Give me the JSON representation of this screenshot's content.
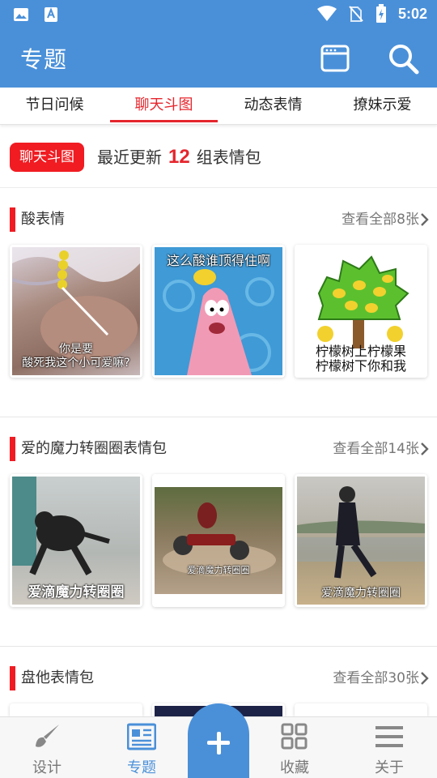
{
  "status_bar": {
    "time": "5:02"
  },
  "app_bar": {
    "title": "专题"
  },
  "tabs": [
    {
      "label": "节日问候"
    },
    {
      "label": "聊天斗图",
      "active": true
    },
    {
      "label": "动态表情"
    },
    {
      "label": "撩妹示爱"
    }
  ],
  "summary": {
    "badge": "聊天斗图",
    "prefix": "最近更新",
    "count": "12",
    "suffix": "组表情包"
  },
  "sections": [
    {
      "title": "酸表情",
      "more": "查看全部8张",
      "items": [
        {
          "caption_1": "你是要",
          "caption_2": "酸死我这个小可爱嘛?"
        },
        {
          "caption_1": "这么酸谁顶得住啊"
        },
        {
          "caption_1": "柠檬树上柠檬果",
          "caption_2": "柠檬树下你和我"
        }
      ]
    },
    {
      "title": "爱的魔力转圈圈表情包",
      "more": "查看全部14张",
      "items": [
        {
          "caption_1": "爱滴魔力转圈圈"
        },
        {
          "caption_1": "爱滴魔力转圈圈"
        },
        {
          "caption_1": "爱滴魔力转圈圈"
        }
      ]
    },
    {
      "title": "盘他表情包",
      "more": "查看全部30张"
    }
  ],
  "bottom_nav": [
    {
      "label": "设计"
    },
    {
      "label": "专题",
      "active": true
    },
    {
      "label": "收藏"
    },
    {
      "label": "关于"
    }
  ],
  "colors": {
    "primary": "#4a90d9",
    "accent": "#e5262d",
    "badge": "#f01c22"
  }
}
